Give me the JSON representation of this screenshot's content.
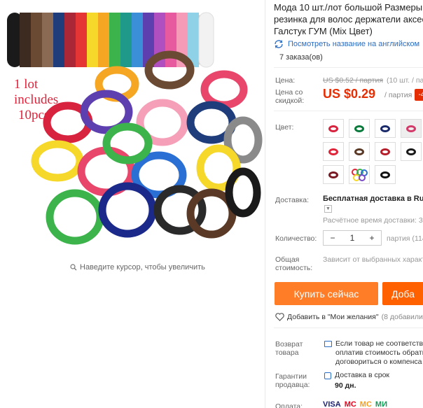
{
  "gallery": {
    "promo_lines": [
      "1 lot",
      "includes",
      "10pcs"
    ],
    "zoom_hint": "Наведите курсор, чтобы увеличить"
  },
  "product": {
    "title_lines": [
      "Мода 10 шт./лот большой Размеры о",
      "резинка для волос держатели аксесс",
      "Галстук ГУМ (Mix Цвет)"
    ],
    "translate_link": "Посмотреть название на английском",
    "orders": "7 заказа(ов)"
  },
  "price": {
    "label": "Цена:",
    "original": "US $0.52 / партия",
    "original_extra": "(10 шт. / пар",
    "discount_label_lines": [
      "Цена со",
      "скидкой:"
    ],
    "current": "US $0.29",
    "per": "/ партия",
    "badge": "-4"
  },
  "color": {
    "label": "Цвет:",
    "swatches": [
      {
        "name": "red-ring",
        "color": "#d8233f"
      },
      {
        "name": "green-ring",
        "color": "#0a7a3c"
      },
      {
        "name": "navy-ring",
        "color": "#1a2a6a"
      },
      {
        "name": "pink-ring",
        "color": "#d23a6a"
      },
      {
        "name": "red-ring-2",
        "color": "#e0243a"
      },
      {
        "name": "brown-ring",
        "color": "#5a3a26"
      },
      {
        "name": "dark-red-ring",
        "color": "#b51f2c"
      },
      {
        "name": "black-ring",
        "color": "#1a1a1a"
      },
      {
        "name": "maroon-ring",
        "color": "#7a1a24"
      },
      {
        "name": "multicolor-ring",
        "color": "#7a4ac8"
      },
      {
        "name": "black-ring-2",
        "color": "#111111"
      }
    ]
  },
  "delivery": {
    "label": "Доставка:",
    "value": "Бесплатная доставка в Russi",
    "estimate": "Расчётное время доставки: 30"
  },
  "quantity": {
    "label": "Количество:",
    "minus": "−",
    "value": "1",
    "plus": "+",
    "unit": "партия (114"
  },
  "total": {
    "label_lines": [
      "Общая",
      "стоимость:"
    ],
    "value": "Зависит от выбранных характ"
  },
  "actions": {
    "buy_now": "Купить сейчас",
    "add_to_cart": "Доба"
  },
  "wishlist": {
    "label": "Добавить в \"Мои желания\"",
    "count": "(8 добавили)"
  },
  "returns": {
    "label_lines": [
      "Возврат",
      "товара"
    ],
    "text_lines": [
      "Если товар не соответству",
      "оплатив стоимость обратн",
      "договориться о компенса"
    ]
  },
  "guarantee": {
    "label_lines": [
      "Гарантии",
      "продавца:"
    ],
    "line1": "Доставка в срок",
    "line2": "90 дн."
  },
  "payment": {
    "label": "Оплата:",
    "methods": [
      "VISA",
      "MC",
      "MC",
      "МИ"
    ]
  }
}
